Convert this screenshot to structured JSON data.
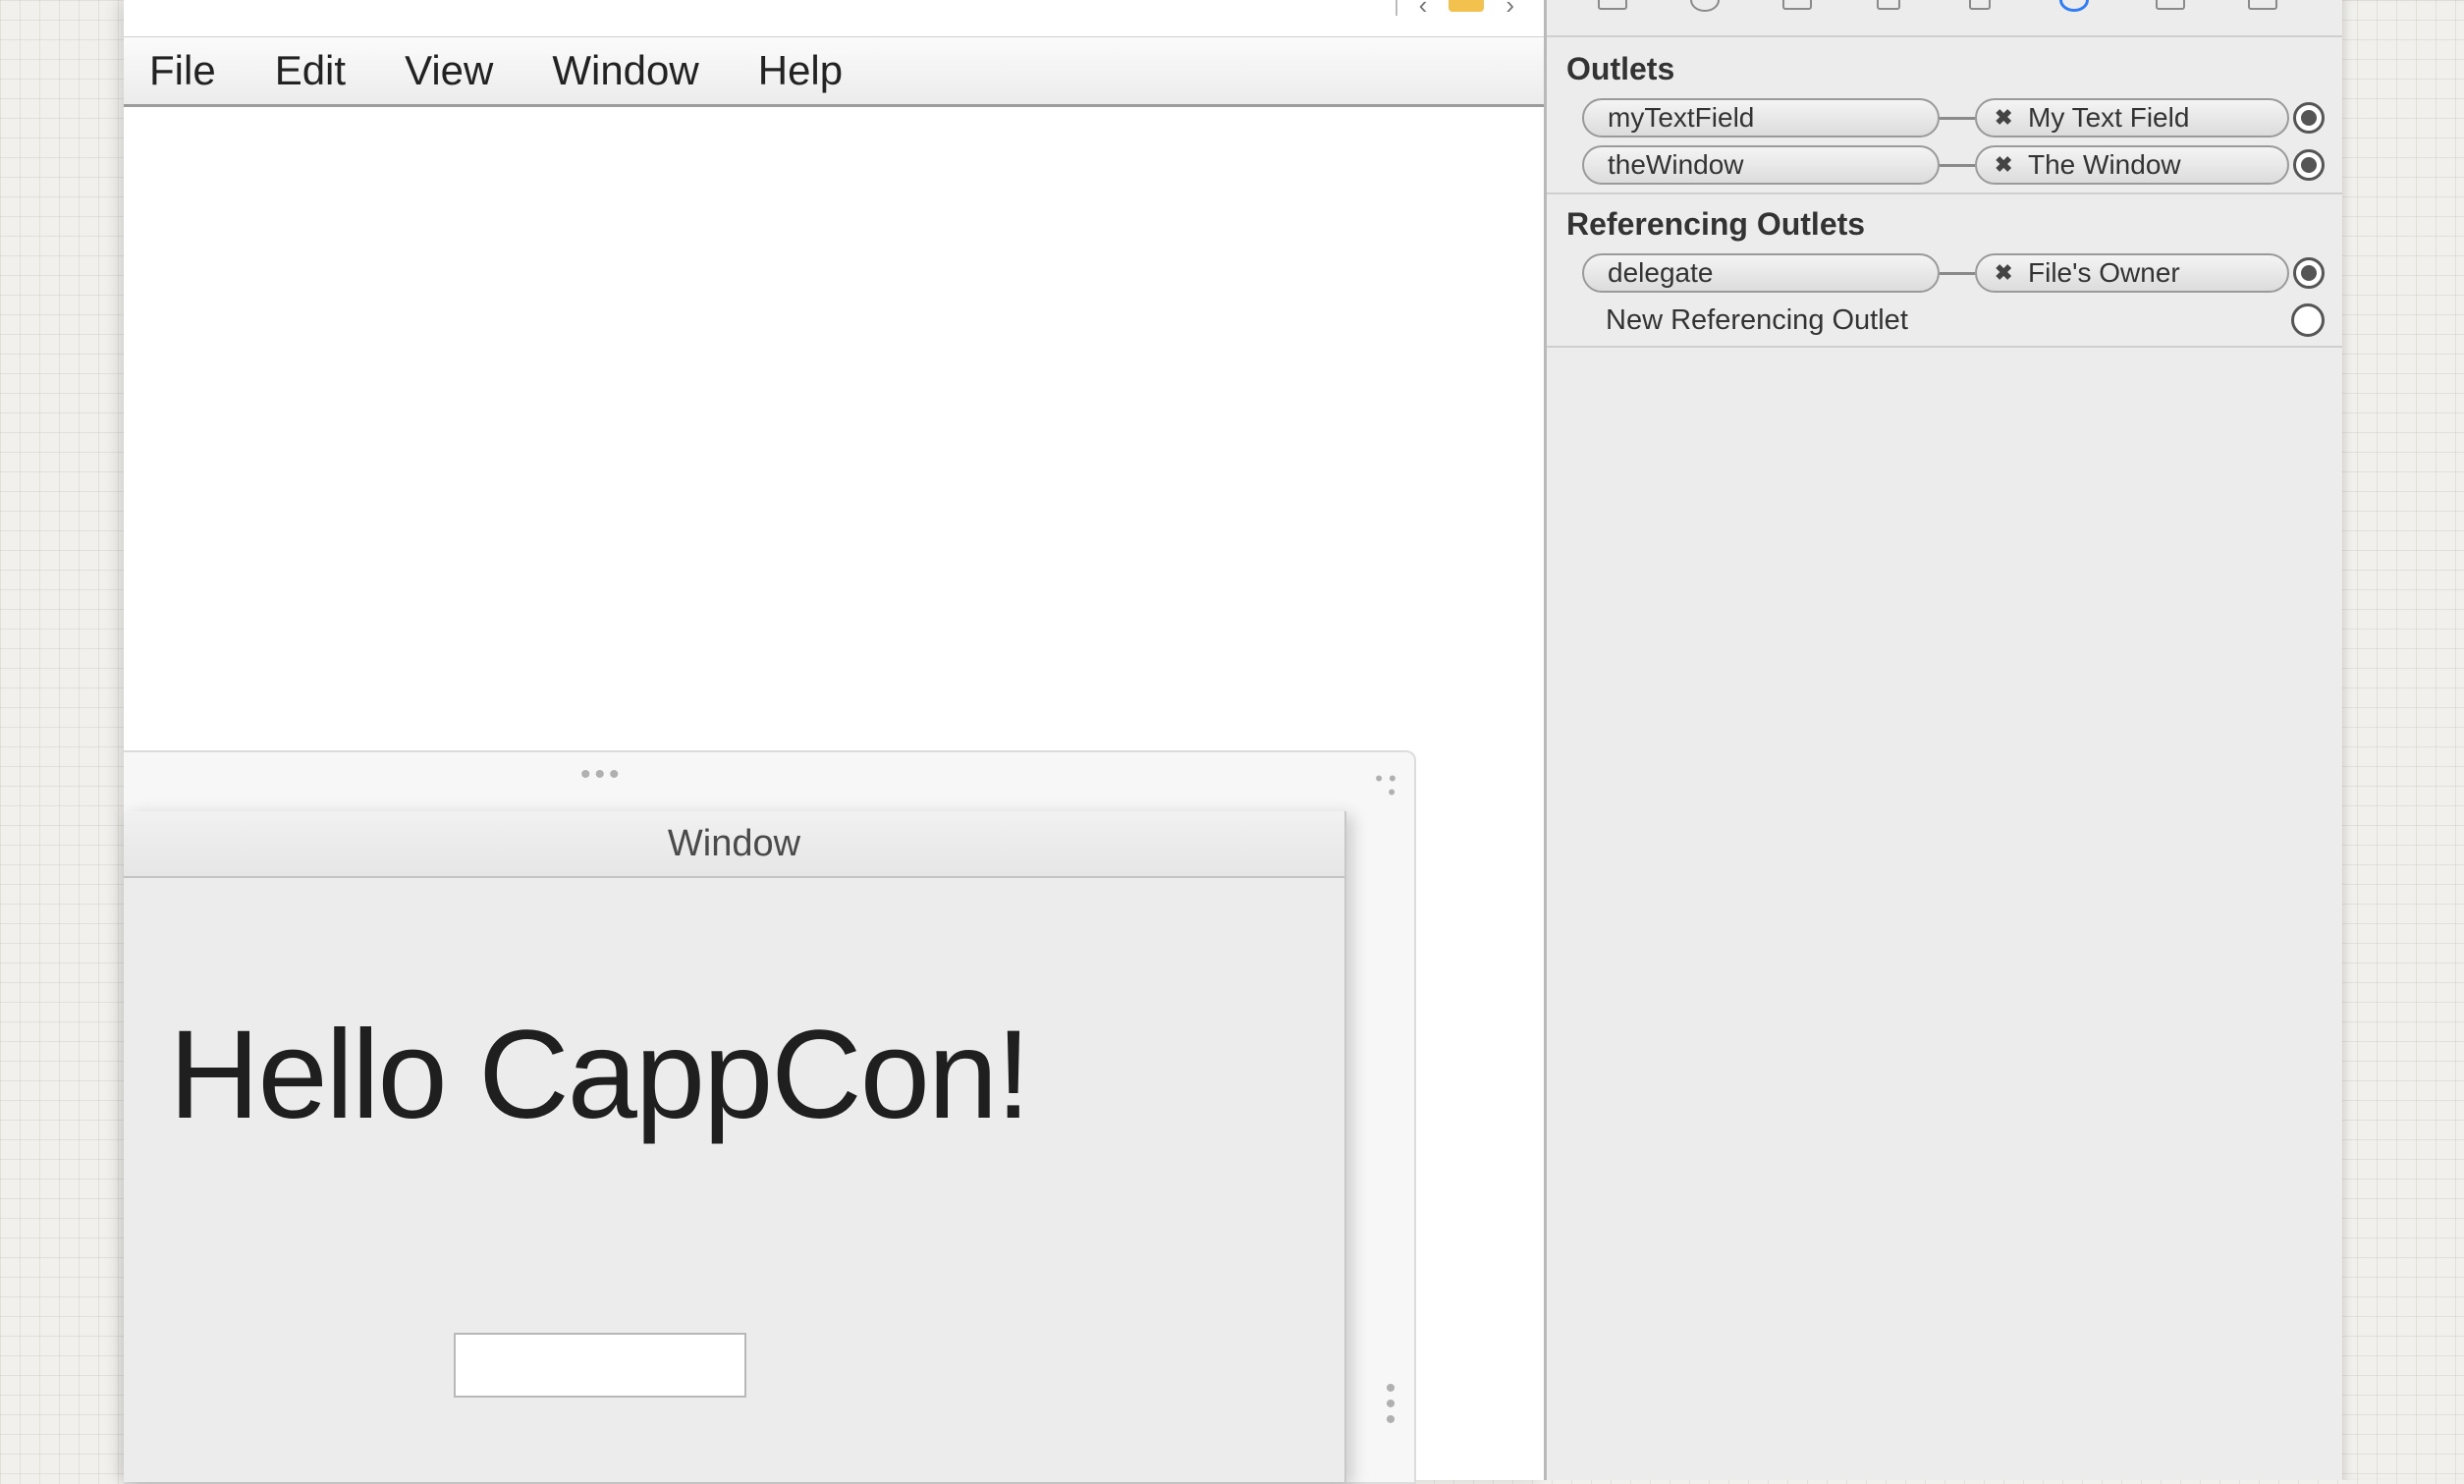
{
  "menubar": {
    "items": [
      "File",
      "Edit",
      "View",
      "Window",
      "Help"
    ]
  },
  "design_window": {
    "title": "Window",
    "label_text": "Hello CappCon!",
    "textfield_value": ""
  },
  "inspector": {
    "outlets_title": "Outlets",
    "outlets": [
      {
        "name": "myTextField",
        "target": "My Text Field"
      },
      {
        "name": "theWindow",
        "target": "The Window"
      }
    ],
    "referencing_title": "Referencing Outlets",
    "referencing": [
      {
        "name": "delegate",
        "target": "File's Owner"
      }
    ],
    "new_referencing_label": "New Referencing Outlet"
  },
  "colors": {
    "accent": "#2f7cf6",
    "canvas": "#ffffff",
    "inspector_bg": "#ececec"
  }
}
